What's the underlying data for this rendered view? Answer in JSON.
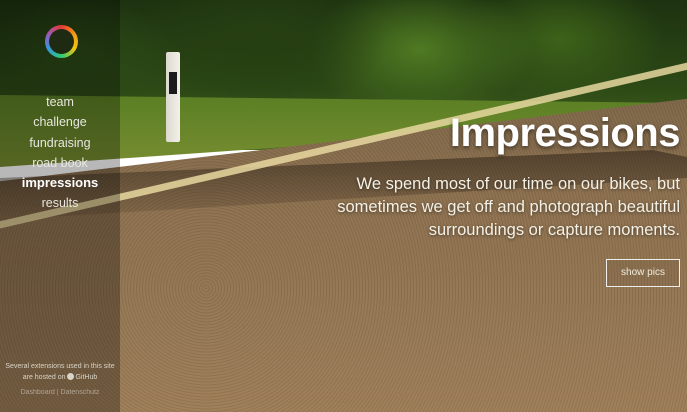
{
  "nav": {
    "logo_name": "ring-logo",
    "items": [
      {
        "label": "team"
      },
      {
        "label": "challenge"
      },
      {
        "label": "fundraising"
      },
      {
        "label": "road book"
      },
      {
        "label": "impressions",
        "active": true
      },
      {
        "label": "results"
      }
    ]
  },
  "hero": {
    "title": "Impressions",
    "lead": "We spend most of our time on our bikes, but sometimes we get off and photograph beautiful surroundings or capture moments.",
    "button_label": "show pics"
  },
  "footer": {
    "line1": "Several extensions used in this site",
    "line2_prefix": "are hosted on",
    "github_label": "GitHub",
    "line3": "Dashboard | Datenschutz"
  },
  "colors": {
    "accent_text": "#ffffff",
    "sidebar_bg": "rgba(0,0,0,0.28)"
  }
}
